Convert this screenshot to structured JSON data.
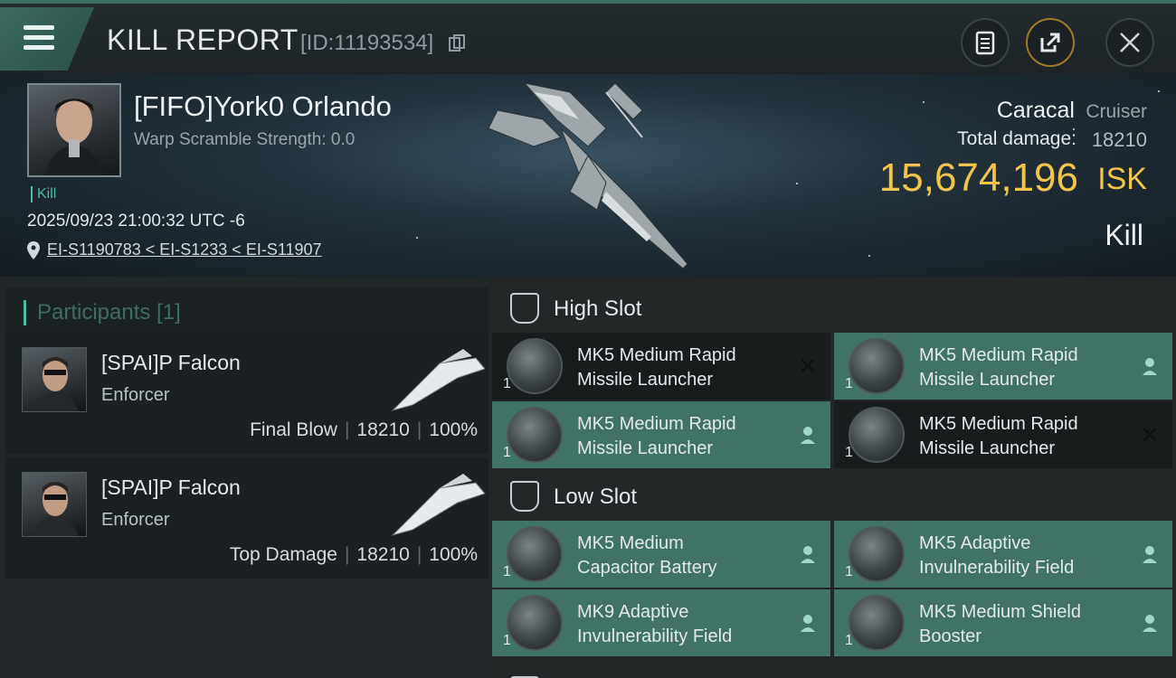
{
  "header": {
    "title": "KILL REPORT",
    "report_id": "[ID:11193534]"
  },
  "victim": {
    "name": "[FIFO]York0 Orlando",
    "warp_scramble": "Warp Scramble Strength: 0.0",
    "kill_tag": "Kill",
    "date": "2025/09/23 21:00:32 UTC -6",
    "location": "EI-S1190783 < EI-S1233 < EI-S11907",
    "ship_name": "Caracal",
    "ship_class": "Cruiser",
    "total_damage_label": "Total damage:",
    "total_damage": "18210",
    "isk_value": "15,674,196",
    "isk_unit": "ISK",
    "result": "Kill"
  },
  "participants": {
    "header": "Participants [1]",
    "items": [
      {
        "name": "[SPAI]P Falcon",
        "ship": "Enforcer",
        "role": "Final Blow",
        "damage": "18210",
        "percent": "100%"
      },
      {
        "name": "[SPAI]P Falcon",
        "ship": "Enforcer",
        "role": "Top Damage",
        "damage": "18210",
        "percent": "100%"
      }
    ]
  },
  "slots": {
    "high": {
      "title": "High Slot",
      "modules": [
        {
          "line1": "MK5 Medium Rapid",
          "line2": "Missile Launcher",
          "qty": "1",
          "status": "destroyed"
        },
        {
          "line1": "MK5 Medium Rapid",
          "line2": "Missile Launcher",
          "qty": "1",
          "status": "dropped"
        },
        {
          "line1": "MK5 Medium Rapid",
          "line2": "Missile Launcher",
          "qty": "1",
          "status": "dropped"
        },
        {
          "line1": "MK5 Medium Rapid",
          "line2": "Missile Launcher",
          "qty": "1",
          "status": "destroyed"
        }
      ]
    },
    "low": {
      "title": "Low Slot",
      "modules": [
        {
          "line1": "MK5 Medium",
          "line2": "Capacitor Battery",
          "qty": "1",
          "status": "dropped"
        },
        {
          "line1": "MK5 Adaptive",
          "line2": "Invulnerability Field",
          "qty": "1",
          "status": "dropped"
        },
        {
          "line1": "MK9 Adaptive",
          "line2": "Invulnerability Field",
          "qty": "1",
          "status": "dropped"
        },
        {
          "line1": "MK5 Medium Shield",
          "line2": "Booster",
          "qty": "1",
          "status": "dropped"
        }
      ]
    }
  },
  "icons": {
    "menu": "hamburger-icon",
    "copy": "copy-icon",
    "clipboard": "clipboard-icon",
    "share": "share-icon",
    "close": "close-icon",
    "location": "location-pin-icon",
    "slot": "slot-shield-icon",
    "dropped": "person-icon",
    "destroyed": "x-icon"
  },
  "colors": {
    "accent": "#4fb9a4",
    "isk": "#f2c44b",
    "fitted_module_bg": "#417268",
    "destroyed_module_bg": "#181c1d"
  }
}
